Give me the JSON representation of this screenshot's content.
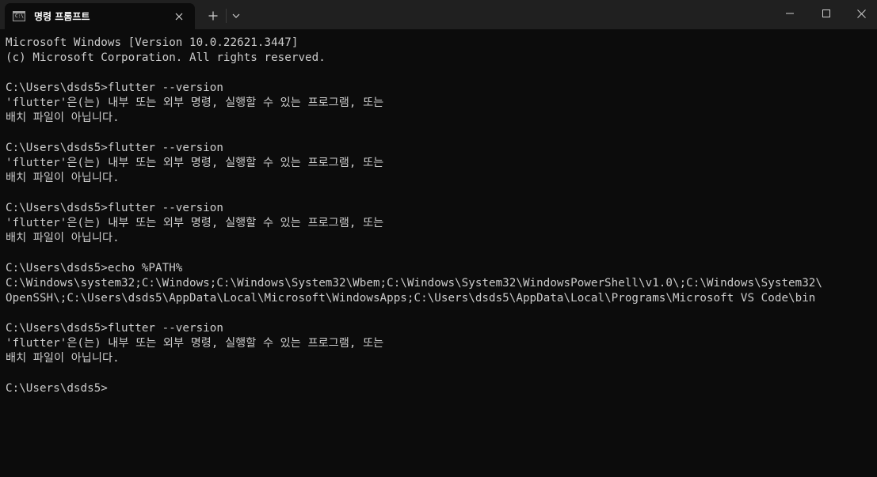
{
  "tab": {
    "icon_text": "C:\\",
    "title": "명령 프롬프트"
  },
  "console": {
    "lines": [
      "Microsoft Windows [Version 10.0.22621.3447]",
      "(c) Microsoft Corporation. All rights reserved.",
      "",
      "C:\\Users\\dsds5>flutter --version",
      "'flutter'은(는) 내부 또는 외부 명령, 실행할 수 있는 프로그램, 또는",
      "배치 파일이 아닙니다.",
      "",
      "C:\\Users\\dsds5>flutter --version",
      "'flutter'은(는) 내부 또는 외부 명령, 실행할 수 있는 프로그램, 또는",
      "배치 파일이 아닙니다.",
      "",
      "C:\\Users\\dsds5>flutter --version",
      "'flutter'은(는) 내부 또는 외부 명령, 실행할 수 있는 프로그램, 또는",
      "배치 파일이 아닙니다.",
      "",
      "C:\\Users\\dsds5>echo %PATH%",
      "C:\\Windows\\system32;C:\\Windows;C:\\Windows\\System32\\Wbem;C:\\Windows\\System32\\WindowsPowerShell\\v1.0\\;C:\\Windows\\System32\\",
      "OpenSSH\\;C:\\Users\\dsds5\\AppData\\Local\\Microsoft\\WindowsApps;C:\\Users\\dsds5\\AppData\\Local\\Programs\\Microsoft VS Code\\bin",
      "",
      "C:\\Users\\dsds5>flutter --version",
      "'flutter'은(는) 내부 또는 외부 명령, 실행할 수 있는 프로그램, 또는",
      "배치 파일이 아닙니다.",
      "",
      "C:\\Users\\dsds5>"
    ]
  },
  "icons": {
    "tab": "cmd-icon",
    "close_tab": "close-icon",
    "new_tab": "plus-icon",
    "dropdown": "chevron-down-icon",
    "minimize": "minimize-icon",
    "maximize": "maximize-icon",
    "close_window": "close-icon"
  },
  "colors": {
    "background": "#0c0c0c",
    "titlebar": "#202020",
    "text": "#cccccc"
  }
}
